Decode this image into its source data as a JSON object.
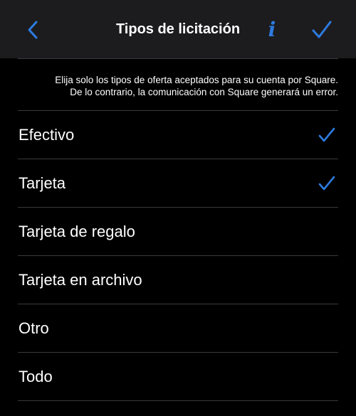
{
  "navbar": {
    "title": "Tipos de licitación",
    "info_label": "i",
    "accent_color": "#2d7be0"
  },
  "notice": {
    "line1": "Elija solo los tipos de oferta aceptados para su cuenta por Square.",
    "line2": "De lo contrario, la comunicación con Square generará un error."
  },
  "tender_types": [
    {
      "label": "Efectivo",
      "checked": true
    },
    {
      "label": "Tarjeta",
      "checked": true
    },
    {
      "label": "Tarjeta de regalo",
      "checked": false
    },
    {
      "label": "Tarjeta en archivo",
      "checked": false
    },
    {
      "label": "Otro",
      "checked": false
    },
    {
      "label": "Todo",
      "checked": false
    }
  ]
}
